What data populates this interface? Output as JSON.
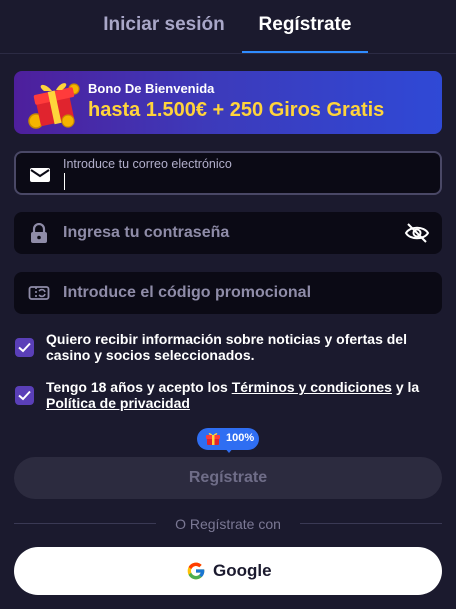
{
  "tabs": {
    "login_label": "Iniciar sesión",
    "register_label": "Regístrate",
    "active": "register"
  },
  "bonus": {
    "title": "Bono De Bienvenida",
    "amount": "hasta 1.500€ + 250 Giros Gratis",
    "icon": "gift-icon"
  },
  "form": {
    "email": {
      "label": "Introduce tu correo electrónico",
      "value": "",
      "icon": "envelope-icon"
    },
    "password": {
      "placeholder": "Ingresa tu contraseña",
      "icon": "lock-icon",
      "toggle_icon": "eye-off-icon"
    },
    "promo": {
      "placeholder": "Introduce el código promocional",
      "icon": "ticket-icon"
    }
  },
  "consents": {
    "marketing": {
      "checked": true,
      "text": "Quiero recibir información sobre noticias y ofertas del casino y socios seleccionados."
    },
    "terms": {
      "checked": true,
      "prefix": "Tengo 18 años y acepto los ",
      "terms_link": "Términos y condiciones",
      "middle": " y la ",
      "privacy_link": "Política de privacidad"
    }
  },
  "progress_badge": {
    "value": "100%",
    "icon": "gift-icon"
  },
  "submit": {
    "label": "Regístrate"
  },
  "divider": {
    "text": "O Regístrate con"
  },
  "social": {
    "google_label": "Google",
    "icon": "google-icon"
  },
  "colors": {
    "background": "#1b1a2e",
    "accent": "#2f8cff",
    "checkbox": "#5a3fb8",
    "bonus_amount": "#ffd43b"
  }
}
